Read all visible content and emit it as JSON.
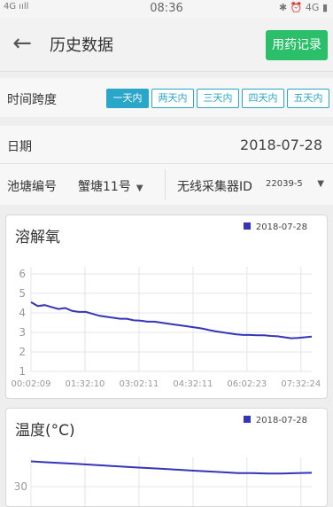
{
  "status_bar": {
    "left": "4G ııll",
    "time": "08:36",
    "right": "✱ ⏰ 4G ▮"
  },
  "header": {
    "title": "历史数据",
    "med_button": "用药记录"
  },
  "span": {
    "label": "时间跨度",
    "options": [
      "一天内",
      "两天内",
      "三天内",
      "四天内",
      "五天内"
    ],
    "selected_index": 0
  },
  "date": {
    "label": "日期",
    "value": "2018-07-28"
  },
  "filters": {
    "pond_label": "池塘编号",
    "pond_value": "蟹塘11号",
    "collector_label": "无线采集器ID",
    "collector_value": "22039-5"
  },
  "colors": {
    "line": "#3535b8",
    "accent": "#2aa6c8",
    "button": "#2bbf6a"
  },
  "charts": [
    {
      "title": "溶解氧",
      "legend": "2018-07-28",
      "chart_data": {
        "type": "line",
        "series": [
          {
            "name": "2018-07-28",
            "color": "#3535b8",
            "values": [
              4.55,
              4.35,
              4.4,
              4.3,
              4.2,
              4.25,
              4.1,
              4.05,
              4.05,
              3.95,
              3.85,
              3.8,
              3.75,
              3.7,
              3.7,
              3.62,
              3.6,
              3.55,
              3.55,
              3.5,
              3.45,
              3.4,
              3.35,
              3.3,
              3.25,
              3.2,
              3.12,
              3.05,
              3.0,
              2.95,
              2.9,
              2.87,
              2.87,
              2.85,
              2.85,
              2.82,
              2.8,
              2.75,
              2.7,
              2.72,
              2.75,
              2.78
            ]
          }
        ],
        "x_ticks": [
          "00:02:09",
          "01:32:10",
          "03:02:11",
          "04:32:11",
          "06:02:23",
          "07:32:24"
        ],
        "y_ticks": [
          1,
          2,
          3,
          4,
          5,
          6
        ],
        "ylim": [
          1,
          6
        ],
        "grid": true
      }
    },
    {
      "title": "温度(°C)",
      "legend": "2018-07-28",
      "chart_data": {
        "type": "line",
        "series": [
          {
            "name": "2018-07-28",
            "color": "#3535b8",
            "values": [
              31.5,
              31.45,
              31.4,
              31.35,
              31.3,
              31.25,
              31.2,
              31.15,
              31.1,
              31.05,
              31.0,
              30.95,
              30.9,
              30.85,
              30.8,
              30.8,
              30.78,
              30.78,
              30.8,
              30.82
            ]
          }
        ],
        "y_ticks": [
          30
        ],
        "grid": true
      }
    }
  ]
}
